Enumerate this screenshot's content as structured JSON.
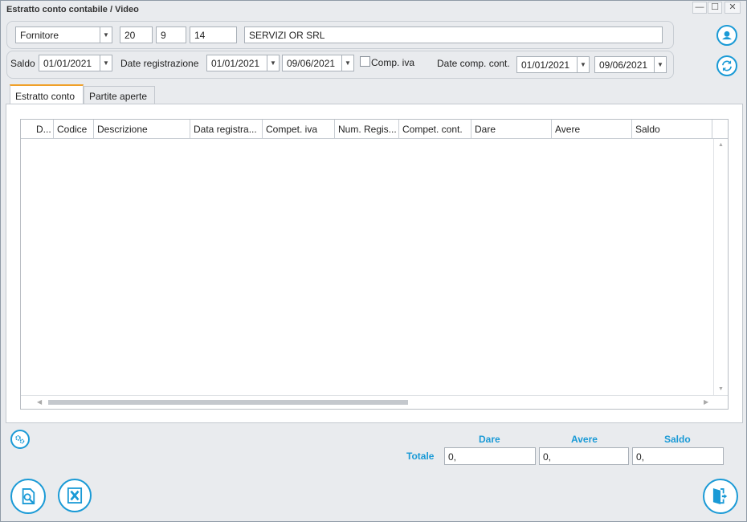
{
  "window": {
    "title": "Estratto conto contabile / Video",
    "controls": {
      "minimize": "—",
      "maximize": "☐",
      "close": "✕"
    }
  },
  "filter": {
    "type": "Fornitore",
    "code1": "20",
    "code2": "9",
    "code3": "14",
    "name": "SERVIZI OR SRL"
  },
  "dates": {
    "saldo_label": "Saldo",
    "saldo_date": "01/01/2021",
    "reg_label": "Date registrazione",
    "reg_from": "01/01/2021",
    "reg_to": "09/06/2021",
    "comp_iva_label": "Comp. iva",
    "comp_cont_label": "Date comp. cont.",
    "comp_from": "01/01/2021",
    "comp_to": "09/06/2021"
  },
  "tabs": [
    {
      "label": "Estratto conto",
      "active": true
    },
    {
      "label": "Partite aperte",
      "active": false
    }
  ],
  "table": {
    "columns": [
      "D...",
      "Codice",
      "Descrizione",
      "Data registra...",
      "Compet. iva",
      "Num. Regis...",
      "Compet. cont.",
      "Dare",
      "Avere",
      "Saldo"
    ],
    "rows": []
  },
  "totals": {
    "label": "Totale",
    "dare_label": "Dare",
    "avere_label": "Avere",
    "saldo_label": "Saldo",
    "dare": "0,",
    "avere": "0,",
    "saldo": "0,"
  },
  "icons": {
    "user": "user-icon",
    "refresh": "refresh-icon",
    "settings": "gears-icon",
    "preview": "preview-icon",
    "excel": "excel-icon",
    "exit": "exit-icon"
  },
  "colors": {
    "accent": "#1a9ad6",
    "tab_highlight": "#f0a028"
  }
}
